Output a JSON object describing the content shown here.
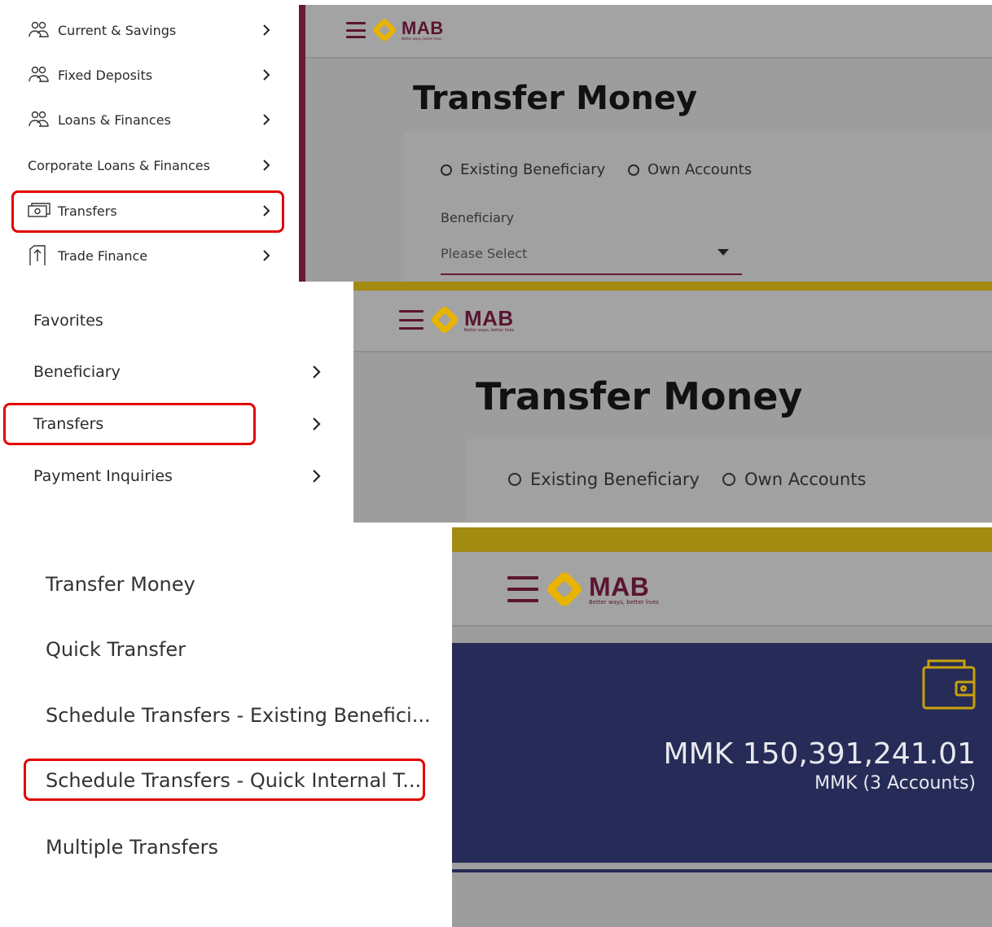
{
  "panel1": {
    "menu": [
      {
        "label": "Current & Savings",
        "icon": "people-icon"
      },
      {
        "label": "Fixed Deposits",
        "icon": "people-icon"
      },
      {
        "label": "Loans & Finances",
        "icon": "people-icon"
      },
      {
        "label": "Corporate Loans & Finances",
        "icon": ""
      },
      {
        "label": "Transfers",
        "icon": "money-icon"
      },
      {
        "label": "Trade Finance",
        "icon": "trade-icon"
      }
    ],
    "brand": {
      "name": "MAB",
      "tagline": "Better ways, better lives"
    },
    "title": "Transfer Money",
    "radio_existing": "Existing Beneficiary",
    "radio_own": "Own Accounts",
    "beneficiary_label": "Beneficiary",
    "beneficiary_placeholder": "Please Select"
  },
  "panel2": {
    "menu": [
      {
        "label": "Favorites"
      },
      {
        "label": "Beneficiary"
      },
      {
        "label": "Transfers"
      },
      {
        "label": "Payment Inquiries"
      }
    ],
    "brand": {
      "name": "MAB",
      "tagline": "Better ways, better lives"
    },
    "title": "Transfer Money",
    "radio_existing": "Existing Beneficiary",
    "radio_own": "Own Accounts"
  },
  "panel3": {
    "menu": [
      {
        "label": "Transfer Money"
      },
      {
        "label": "Quick Transfer"
      },
      {
        "label": "Schedule Transfers - Existing Benefici..."
      },
      {
        "label": "Schedule Transfers - Quick Internal T..."
      },
      {
        "label": "Multiple Transfers"
      }
    ],
    "brand": {
      "name": "MAB",
      "tagline": "Better ways, better lives"
    },
    "balance": "MMK 150,391,241.01",
    "balance_sub": "MMK (3 Accounts)"
  },
  "colors": {
    "highlight": "#e10600",
    "brand_maroon": "#5a1530",
    "brand_gold": "#e8b400",
    "balance_card": "#262c57",
    "accent_bar": "#a38a10"
  }
}
